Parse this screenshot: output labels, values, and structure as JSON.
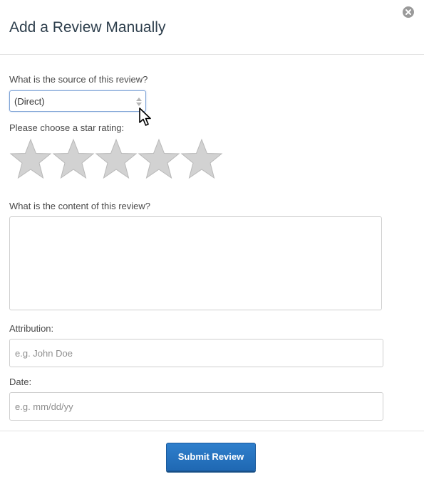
{
  "modal": {
    "title": "Add a Review Manually",
    "close_icon": "close-circle-icon"
  },
  "form": {
    "source": {
      "label": "What is the source of this review?",
      "selected": "(Direct)"
    },
    "rating": {
      "label": "Please choose a star rating:",
      "max_stars": 5,
      "selected_stars": 0,
      "star_color": "#d2d2d2"
    },
    "content": {
      "label": "What is the content of this review?",
      "value": ""
    },
    "attribution": {
      "label": "Attribution:",
      "placeholder": "e.g. John Doe"
    },
    "date": {
      "label": "Date:",
      "placeholder": "e.g. mm/dd/yy"
    }
  },
  "footer": {
    "submit_label": "Submit Review",
    "submit_color": "#2574c2"
  }
}
